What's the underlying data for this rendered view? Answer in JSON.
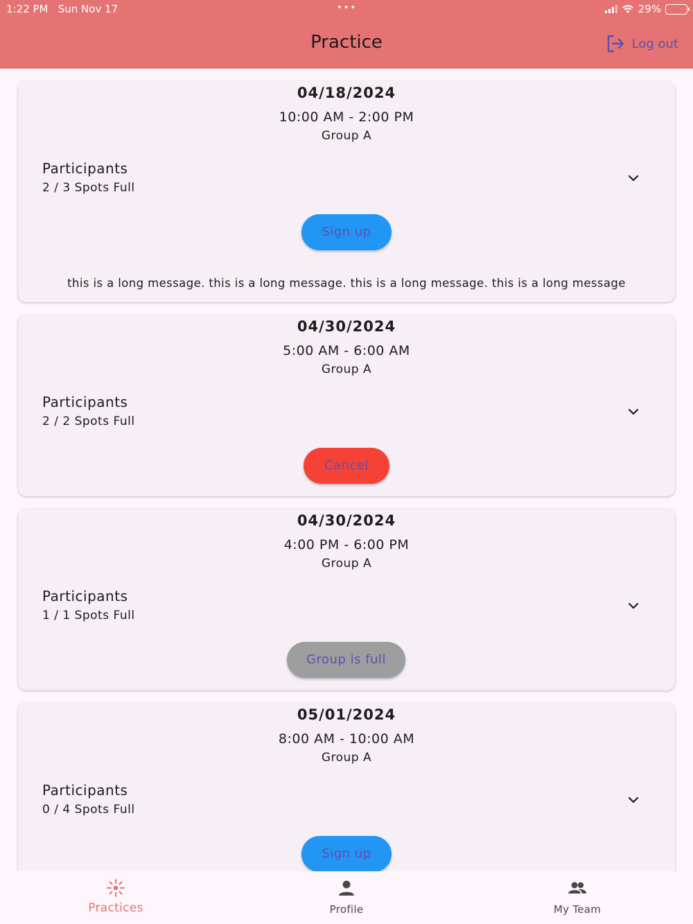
{
  "status_bar": {
    "time": "1:22 PM",
    "date": "Sun Nov 17",
    "dots": "•••",
    "battery": "29%",
    "battery_level": 0.29
  },
  "header": {
    "title": "Practice",
    "logout_label": "Log out"
  },
  "colors": {
    "appbar": "#e57373",
    "signup": "#2196f3",
    "cancel": "#f44336",
    "full": "#9e9e9e",
    "button_text": "#5e4fb3",
    "active_nav": "#e57373"
  },
  "practices": [
    {
      "date": "04/18/2024",
      "time": "10:00 AM - 2:00 PM",
      "group": "Group A",
      "participants_label": "Participants",
      "spots": "2 / 3 Spots Full",
      "button": "Sign up",
      "button_type": "signup",
      "message": "this is a long message. this is a long message. this is a long message. this is a long message"
    },
    {
      "date": "04/30/2024",
      "time": "5:00 AM - 6:00 AM",
      "group": "Group A",
      "participants_label": "Participants",
      "spots": "2 / 2 Spots Full",
      "button": "Cancel",
      "button_type": "cancel"
    },
    {
      "date": "04/30/2024",
      "time": "4:00 PM - 6:00 PM",
      "group": "Group A",
      "participants_label": "Participants",
      "spots": "1 / 1 Spots Full",
      "button": "Group is full",
      "button_type": "full"
    },
    {
      "date": "05/01/2024",
      "time": "8:00 AM - 10:00 AM",
      "group": "Group A",
      "participants_label": "Participants",
      "spots": "0 / 4 Spots Full",
      "button": "Sign up",
      "button_type": "signup"
    }
  ],
  "bottom_nav": [
    {
      "label": "Practices",
      "icon": "practice-icon",
      "active": true
    },
    {
      "label": "Profile",
      "icon": "person-icon",
      "active": false
    },
    {
      "label": "My Team",
      "icon": "group-icon",
      "active": false
    }
  ]
}
